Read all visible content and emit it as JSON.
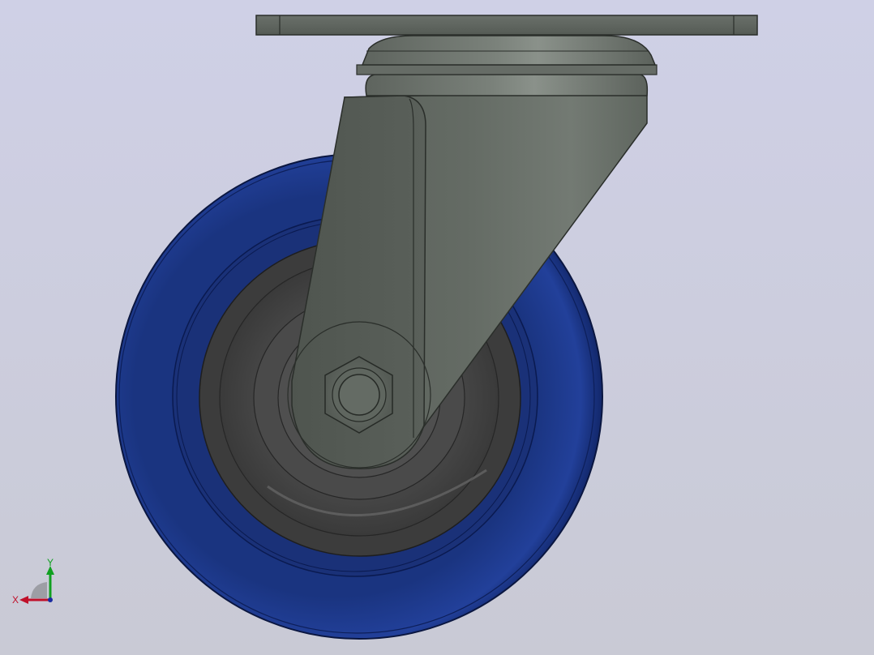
{
  "viewport": {
    "background_top": "#cfd0e6",
    "background_bottom": "#cacbd6"
  },
  "model": {
    "name": "swivel-caster",
    "parts": [
      "mounting-plate",
      "swivel-bearing",
      "fork",
      "wheel-tread",
      "wheel-hub",
      "axle-nut"
    ],
    "colors": {
      "tread": "#1a3480",
      "tread_edge": "#0a1a55",
      "hub": "#4a4a4a",
      "fork": "#6a716a",
      "plate": "#5e645e"
    }
  },
  "triad": {
    "x_label": "X",
    "y_label": "Y",
    "x_color": "#c0102a",
    "y_color": "#10a020",
    "z_color": "#1a2aa0"
  }
}
